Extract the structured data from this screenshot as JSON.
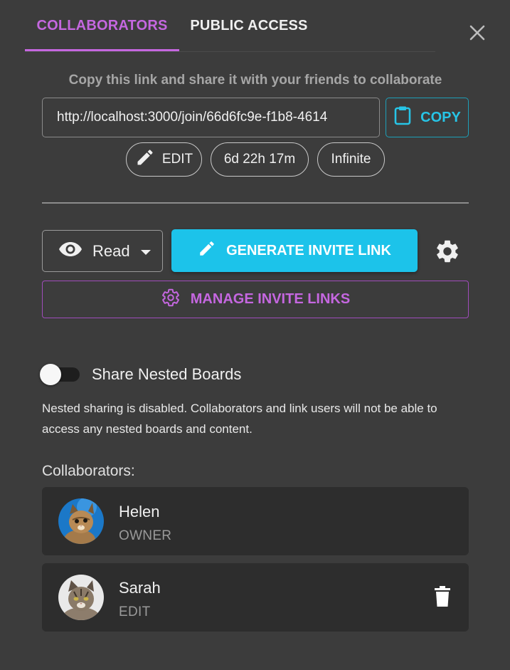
{
  "tabs": [
    {
      "label": "COLLABORATORS",
      "active": true
    },
    {
      "label": "PUBLIC ACCESS",
      "active": false
    }
  ],
  "close_icon": "close-icon",
  "share": {
    "hint": "Copy this link and share it with your friends to collaborate",
    "link_value": "http://localhost:3000/join/66d6fc9e-f1b8-4614",
    "copy_label": "COPY",
    "copy_icon": "clipboard-icon"
  },
  "link_chips": {
    "permission_label": "EDIT",
    "permission_icon": "pencil-icon",
    "expiry": "6d 22h 17m",
    "usage": "Infinite"
  },
  "invite": {
    "permission_value": "Read",
    "permission_icon": "eye-icon",
    "generate_label": "GENERATE INVITE LINK",
    "manage_label": "MANAGE INVITE LINKS"
  },
  "nested": {
    "toggle_label": "Share Nested Boards",
    "enabled": false,
    "info": "Nested sharing is disabled. Collaborators and link users will not be able to access any nested boards and content."
  },
  "collaborators": {
    "heading": "Collaborators:",
    "items": [
      {
        "name": "Helen",
        "role": "OWNER",
        "removable": false
      },
      {
        "name": "Sarah",
        "role": "EDIT",
        "removable": true
      }
    ]
  },
  "colors": {
    "accent_purple": "#c567e0",
    "accent_cyan": "#1cc3ea",
    "background": "#3c3c3c",
    "card": "#2d2d2d"
  }
}
